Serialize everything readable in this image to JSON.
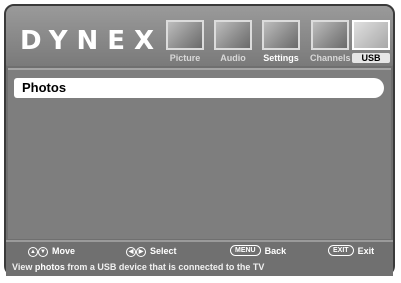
{
  "brand": {
    "logo": "DYNEX"
  },
  "menu": [
    {
      "label": "Picture",
      "icon": "tv-picture-icon"
    },
    {
      "label": "Audio",
      "icon": "audio-icon"
    },
    {
      "label": "Settings",
      "icon": "settings-icon"
    },
    {
      "label": "Channels",
      "icon": "channels-icon"
    },
    {
      "label": "USB",
      "icon": "usb-icon"
    }
  ],
  "content": {
    "items": [
      {
        "label": "Photos"
      }
    ]
  },
  "footer": {
    "hints": [
      {
        "key": "up-down-arrows-icon",
        "label": "Move"
      },
      {
        "key": "left-right-arrows-icon",
        "label": "Select"
      },
      {
        "key_text": "MENU",
        "label": "Back"
      },
      {
        "key_text": "EXIT",
        "label": "Exit"
      }
    ],
    "description_prefix": "View ",
    "description_bold": "photos",
    "description_suffix": " from a USB device that is connected to the TV"
  }
}
